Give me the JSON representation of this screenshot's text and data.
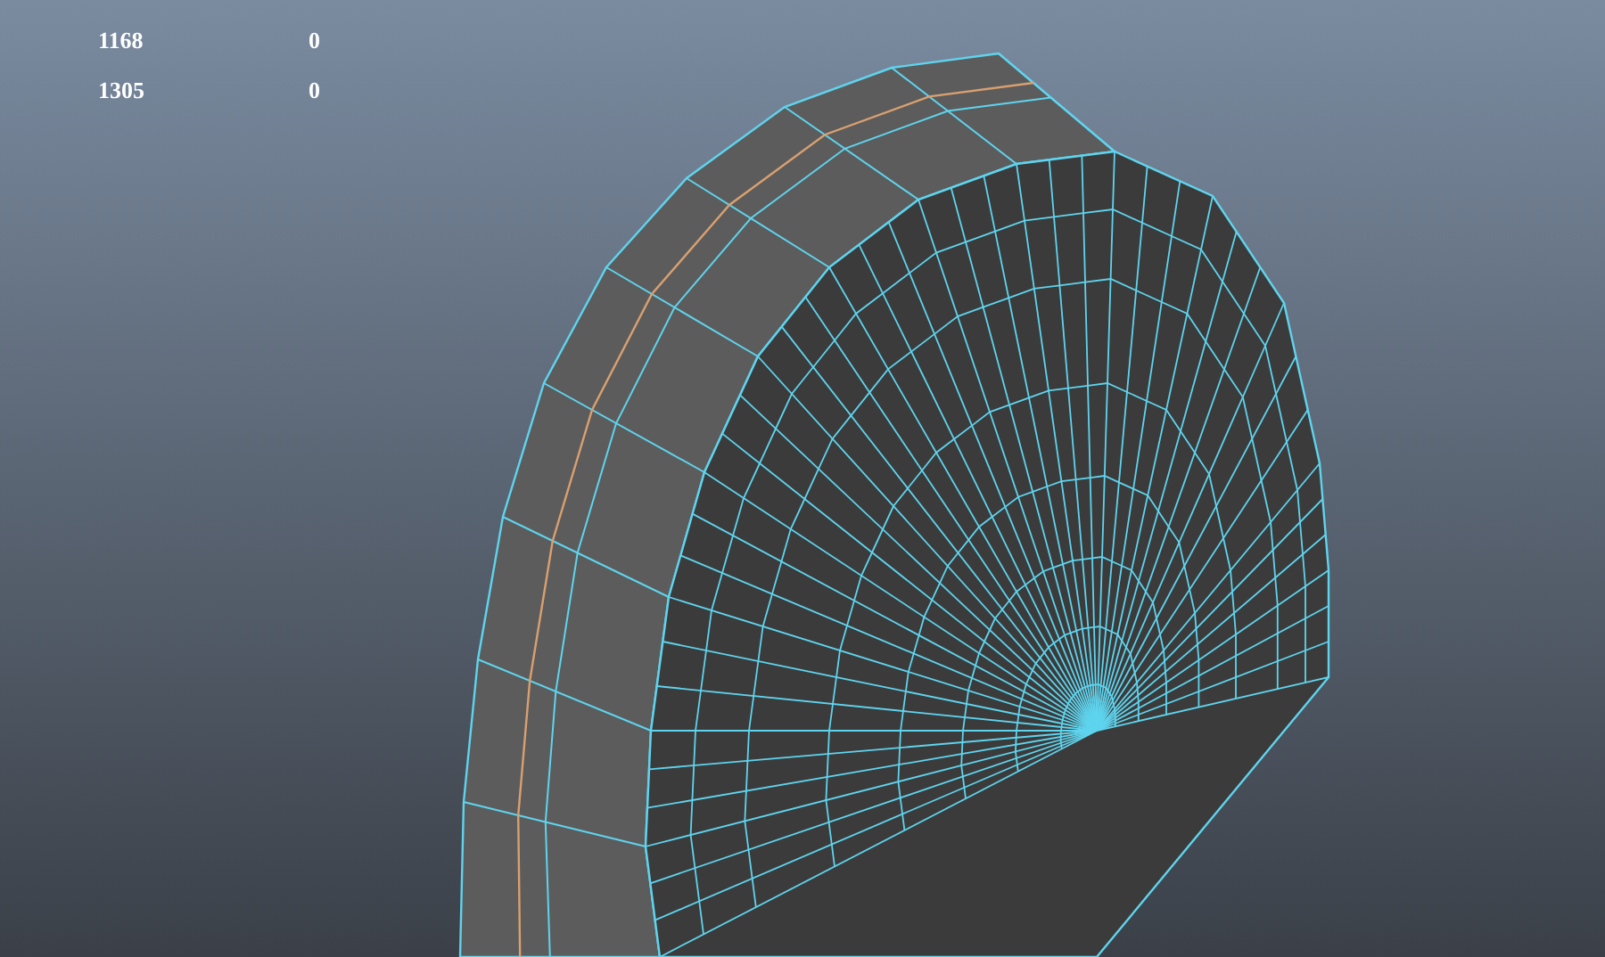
{
  "hud": {
    "rows": [
      {
        "column_1": "1168",
        "column_2": "0"
      },
      {
        "column_1": "1305",
        "column_2": "0"
      }
    ]
  }
}
